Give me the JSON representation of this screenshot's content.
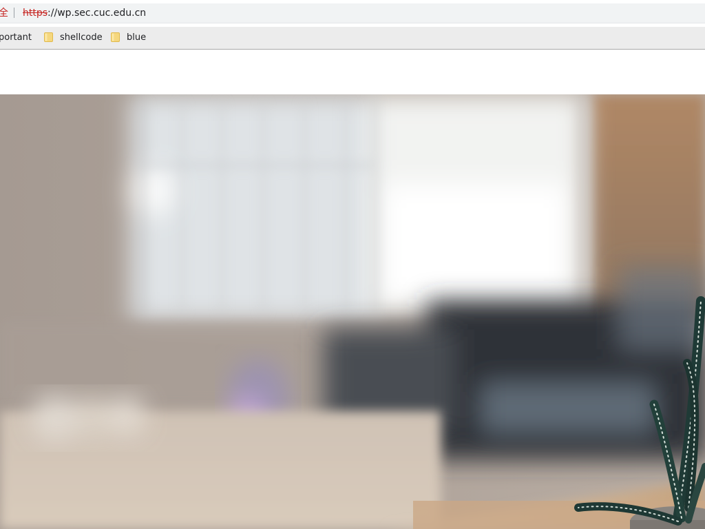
{
  "browser": {
    "address_bar": {
      "security_label": "全",
      "url_scheme": "https",
      "url_rest": "://wp.sec.cuc.edu.cn"
    },
    "bookmarks": [
      {
        "label": "portant",
        "icon": "folder-icon"
      },
      {
        "label": "shellcode",
        "icon": "folder-icon"
      },
      {
        "label": "blue",
        "icon": "folder-icon"
      }
    ]
  },
  "page": {
    "hero_image": {
      "icon": "hero-photo"
    }
  },
  "colors": {
    "security_red": "#c5221f",
    "bookmark_folder": "#f5d77e",
    "bookmark_bar_bg": "#ececec",
    "omnibox_bg": "#f1f3f4"
  }
}
